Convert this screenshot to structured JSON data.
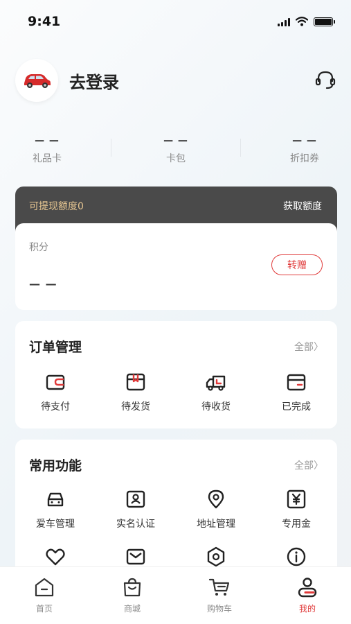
{
  "status_bar": {
    "time": "9:41",
    "battery_level": 1.0
  },
  "profile": {
    "login_label": "去登录",
    "avatar_icon": "car-icon",
    "service_icon": "customer-service-icon"
  },
  "stats": [
    {
      "value": "— —",
      "label": "礼品卡"
    },
    {
      "value": "— —",
      "label": "卡包"
    },
    {
      "value": "— —",
      "label": "折扣券"
    }
  ],
  "cash": {
    "left_label": "可提现额度0",
    "right_label": "获取额度"
  },
  "points": {
    "label": "积分",
    "value": "— —",
    "button": "转赠"
  },
  "orders": {
    "title": "订单管理",
    "more": "全部〉",
    "items": [
      {
        "label": "待支付",
        "icon": "wallet-icon"
      },
      {
        "label": "待发货",
        "icon": "package-icon"
      },
      {
        "label": "待收货",
        "icon": "truck-icon"
      },
      {
        "label": "已完成",
        "icon": "card-done-icon"
      }
    ]
  },
  "features": {
    "title": "常用功能",
    "more": "全部〉",
    "items": [
      {
        "label": "爱车管理",
        "icon": "car-outline-icon"
      },
      {
        "label": "实名认证",
        "icon": "id-card-icon"
      },
      {
        "label": "地址管理",
        "icon": "location-icon"
      },
      {
        "label": "专用金",
        "icon": "yen-icon"
      },
      {
        "label": "",
        "icon": "heart-icon"
      },
      {
        "label": "",
        "icon": "mail-icon"
      },
      {
        "label": "",
        "icon": "hexagon-icon"
      },
      {
        "label": "",
        "icon": "info-icon"
      }
    ]
  },
  "tabs": [
    {
      "label": "首页",
      "icon": "home-icon",
      "active": false
    },
    {
      "label": "商城",
      "icon": "shopping-bag-icon",
      "active": false
    },
    {
      "label": "购物车",
      "icon": "cart-icon",
      "active": false
    },
    {
      "label": "我的",
      "icon": "profile-icon",
      "active": true
    }
  ],
  "colors": {
    "accent": "#e03a3a",
    "cash_card": "#4a4a4a",
    "cash_gold": "#e7c792"
  }
}
